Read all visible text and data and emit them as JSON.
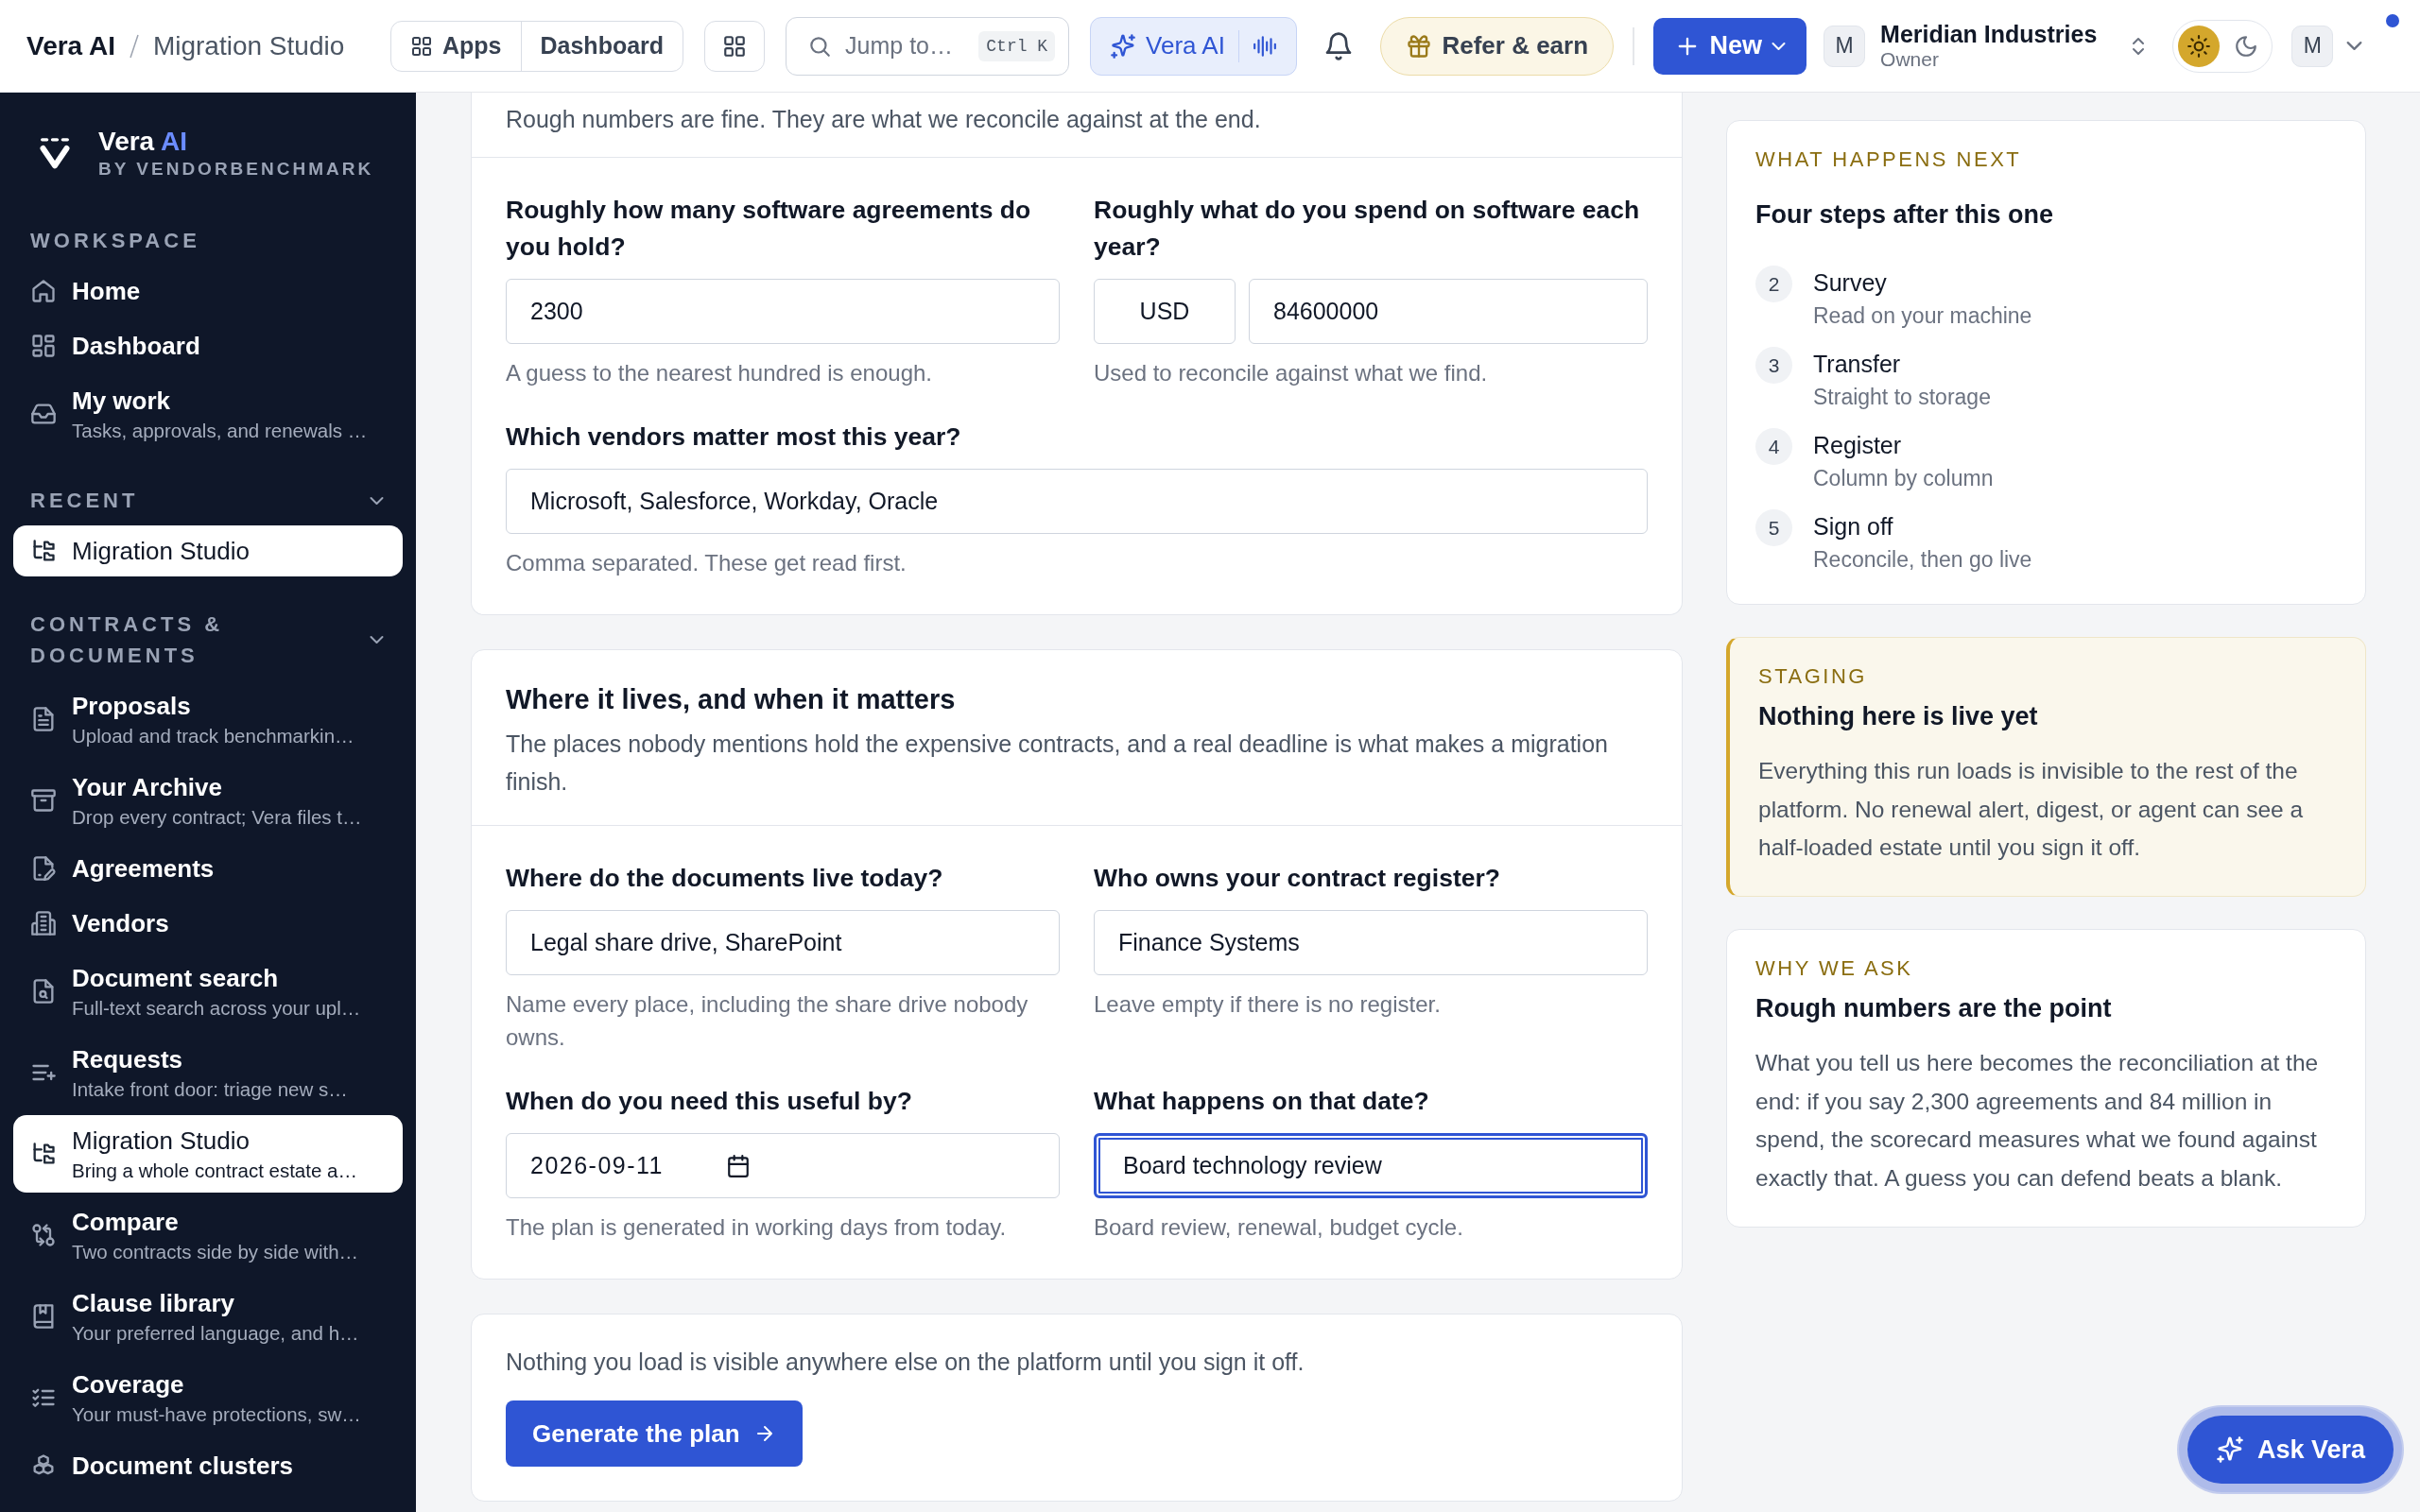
{
  "topbar": {
    "breadcrumb": [
      "Vera AI",
      "Migration Studio"
    ],
    "nav": [
      {
        "label": "Apps"
      },
      {
        "label": "Dashboard"
      }
    ],
    "search": {
      "placeholder": "Jump to…",
      "shortcut": "Ctrl K"
    },
    "assistant": "Vera AI",
    "refer": "Refer & earn",
    "new": "New",
    "org": {
      "initial": "M",
      "name": "Meridian Industries",
      "role": "Owner"
    },
    "theme": [
      {
        "selected": true
      },
      {
        "selected": false
      }
    ],
    "user": {
      "initial": "M",
      "unread": true
    }
  },
  "sidebar": {
    "brand": {
      "name": "Vera",
      "accent": "AI",
      "byline": "BY VENDORBENCHMARK"
    },
    "sections": [
      {
        "title": "WORKSPACE",
        "items": [
          {
            "title": "Home",
            "selected": false
          },
          {
            "title": "Dashboard",
            "selected": false
          },
          {
            "title": "My work",
            "subtitle": "Tasks, approvals, and renewals …",
            "selected": false
          }
        ]
      },
      {
        "title": "RECENT",
        "expanded": true,
        "items": [
          {
            "title": "Migration Studio",
            "selected": true
          }
        ]
      },
      {
        "title": "CONTRACTS & DOCUMENTS",
        "expanded": true,
        "items": [
          {
            "title": "Proposals",
            "subtitle": "Upload and track benchmarkin…",
            "selected": false
          },
          {
            "title": "Your Archive",
            "subtitle": "Drop every contract; Vera files t…",
            "selected": false
          },
          {
            "title": "Agreements",
            "selected": false
          },
          {
            "title": "Vendors",
            "selected": false
          },
          {
            "title": "Document search",
            "subtitle": "Full-text search across your upl…",
            "selected": false
          },
          {
            "title": "Requests",
            "subtitle": "Intake front door: triage new s…",
            "selected": false
          },
          {
            "title": "Migration Studio",
            "subtitle": "Bring a whole contract estate a…",
            "selected": true
          },
          {
            "title": "Compare",
            "subtitle": "Two contracts side by side with…",
            "selected": false
          },
          {
            "title": "Clause library",
            "subtitle": "Your preferred language, and h…",
            "selected": false
          },
          {
            "title": "Coverage",
            "subtitle": "Your must-have protections, sw…",
            "selected": false
          },
          {
            "title": "Document clusters",
            "selected": false
          }
        ]
      }
    ]
  },
  "main": {
    "cards": [
      {
        "description": "Rough numbers are fine. They are what we reconcile against at the end.",
        "rows": [
          [
            {
              "kind": "text",
              "label": "Roughly how many software agreements do you hold?",
              "value": "2300",
              "hint": "A guess to the nearest hundred is enough.",
              "focused": false
            },
            {
              "kind": "currency",
              "label": "Roughly what do you spend on software each year?",
              "currency": "USD",
              "value": "84600000",
              "hint": "Used to reconcile against what we find.",
              "focused": false
            }
          ],
          [
            {
              "kind": "text",
              "label": "Which vendors matter most this year?",
              "value": "Microsoft, Salesforce, Workday, Oracle",
              "hint": "Comma separated. These get read first.",
              "focused": false
            }
          ]
        ]
      },
      {
        "title": "Where it lives, and when it matters",
        "description": "The places nobody mentions hold the expensive contracts, and a real deadline is what makes a migration finish.",
        "rows": [
          [
            {
              "kind": "text",
              "label": "Where do the documents live today?",
              "value": "Legal share drive, SharePoint",
              "hint": "Name every place, including the share drive nobody owns.",
              "focused": false
            },
            {
              "kind": "text",
              "label": "Who owns your contract register?",
              "value": "Finance Systems",
              "hint": "Leave empty if there is no register.",
              "focused": false
            }
          ],
          [
            {
              "kind": "date",
              "label": "When do you need this useful by?",
              "value": "2026-09-11",
              "hint": "The plan is generated in working days from today.",
              "focused": false
            },
            {
              "kind": "text",
              "label": "What happens on that date?",
              "value": "Board technology review",
              "hint": "Board review, renewal, budget cycle.",
              "focused": true
            }
          ]
        ]
      },
      {
        "note": "Nothing you load is visible anywhere else on the platform until you sign it off.",
        "button": "Generate the plan"
      }
    ]
  },
  "aside": {
    "cards": [
      {
        "kind": "steps",
        "eyebrow": "WHAT HAPPENS NEXT",
        "title": "Four steps after this one",
        "steps": [
          {
            "number": "2",
            "title": "Survey",
            "subtitle": "Read on your machine"
          },
          {
            "number": "3",
            "title": "Transfer",
            "subtitle": "Straight to storage"
          },
          {
            "number": "4",
            "title": "Register",
            "subtitle": "Column by column"
          },
          {
            "number": "5",
            "title": "Sign off",
            "subtitle": "Reconcile, then go live"
          }
        ]
      },
      {
        "kind": "notice",
        "eyebrow": "STAGING",
        "title": "Nothing here is live yet",
        "body": "Everything this run loads is invisible to the rest of the platform. No renewal alert, digest, or agent can see a half-loaded estate until you sign it off."
      },
      {
        "kind": "info",
        "eyebrow": "WHY WE ASK",
        "title": "Rough numbers are the point",
        "body": "What you tell us here becomes the reconciliation at the end: if you say 2,300 agreements and 84 million in spend, the scorecard measures what we found against exactly that. A guess you can defend beats a blank."
      }
    ]
  },
  "ask_button": "Ask Vera"
}
